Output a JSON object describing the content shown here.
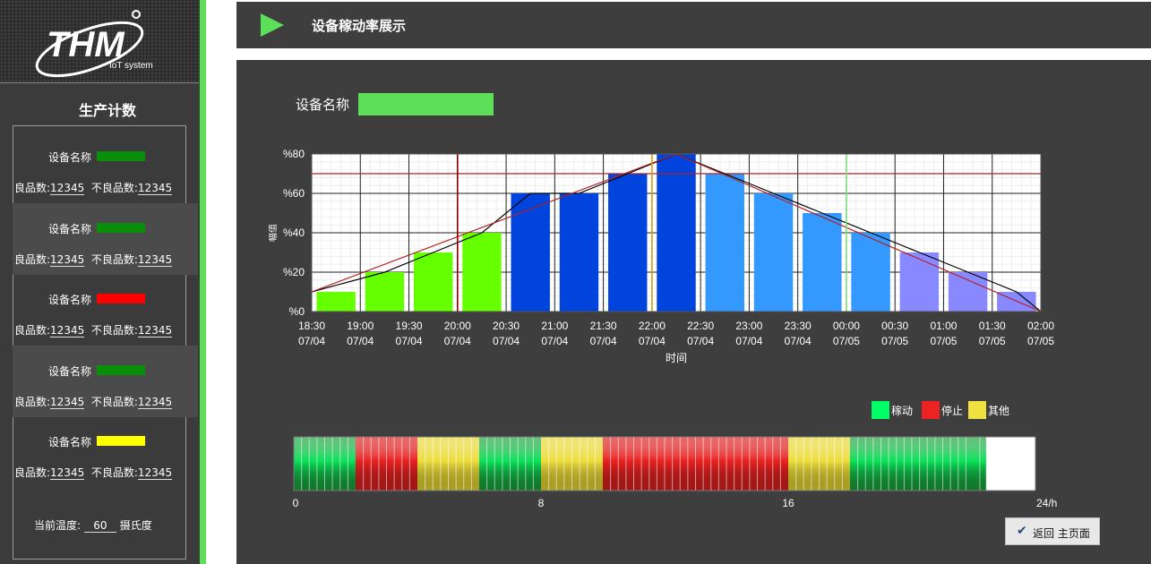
{
  "logo": {
    "brand": "THM",
    "sub": "IoT system"
  },
  "sidebar": {
    "title": "生产计数",
    "cards": [
      {
        "name": "设备名称",
        "status_color": "#0a8f0a",
        "good_label": "良品数:",
        "good_value": "12345",
        "bad_label": "不良品数:",
        "bad_value": "12345"
      },
      {
        "name": "设备名称",
        "status_color": "#0a8f0a",
        "good_label": "良品数:",
        "good_value": "12345",
        "bad_label": "不良品数:",
        "bad_value": "12345"
      },
      {
        "name": "设备名称",
        "status_color": "#ff0000",
        "good_label": "良品数:",
        "good_value": "12345",
        "bad_label": "不良品数:",
        "bad_value": "12345"
      },
      {
        "name": "设备名称",
        "status_color": "#0a8f0a",
        "good_label": "良品数:",
        "good_value": "12345",
        "bad_label": "不良品数:",
        "bad_value": "12345"
      },
      {
        "name": "设备名称",
        "status_color": "#ffff00",
        "good_label": "良品数:",
        "good_value": "12345",
        "bad_label": "不良品数:",
        "bad_value": "12345"
      }
    ],
    "temperature": {
      "label": "当前温度:",
      "value": "60",
      "unit": "摄氏度"
    }
  },
  "header": {
    "title": "设备稼动率展示",
    "icon": "play-icon"
  },
  "device": {
    "label": "设备名称",
    "status_color": "#5ddf5a"
  },
  "chart_data": {
    "type": "bar",
    "xlabel": "时间",
    "ylabel": "幅值",
    "ylim": [
      0,
      80
    ],
    "yticks": [
      "%0",
      "%20",
      "%40",
      "%60",
      "%80"
    ],
    "grid": true,
    "categories": [
      [
        "18:30",
        "07/04"
      ],
      [
        "19:00",
        "07/04"
      ],
      [
        "19:30",
        "07/04"
      ],
      [
        "20:00",
        "07/04"
      ],
      [
        "20:30",
        "07/04"
      ],
      [
        "21:00",
        "07/04"
      ],
      [
        "21:30",
        "07/04"
      ],
      [
        "22:00",
        "07/04"
      ],
      [
        "22:30",
        "07/04"
      ],
      [
        "23:00",
        "07/04"
      ],
      [
        "23:30",
        "07/04"
      ],
      [
        "00:00",
        "07/05"
      ],
      [
        "00:30",
        "07/05"
      ],
      [
        "01:00",
        "07/05"
      ],
      [
        "01:30",
        "07/05"
      ],
      [
        "02:00",
        "07/05"
      ]
    ],
    "values": [
      10,
      20,
      30,
      40,
      60,
      60,
      70,
      80,
      70,
      60,
      50,
      40,
      30,
      20,
      10
    ],
    "bar_colors": [
      "#66ff00",
      "#66ff00",
      "#66ff00",
      "#66ff00",
      "#0044dd",
      "#0044dd",
      "#0044dd",
      "#0044dd",
      "#3399ff",
      "#3399ff",
      "#3399ff",
      "#3399ff",
      "#8888ff",
      "#8888ff",
      "#8888ff"
    ],
    "trend_line": [
      10,
      20,
      30,
      40,
      60,
      60,
      70,
      80,
      70,
      60,
      50,
      40,
      30,
      20,
      10,
      0
    ],
    "reference_line": {
      "value": 70,
      "color": "#b22222"
    },
    "markers": [
      {
        "x": "20:00",
        "color": "#8b0000"
      },
      {
        "x": "22:00",
        "color": "#d4a017"
      },
      {
        "x": "00:00",
        "color": "#7fdd7f"
      }
    ]
  },
  "legend": [
    {
      "label": "稼动",
      "color": "#00ff66"
    },
    {
      "label": "停止",
      "color": "#ee2222"
    },
    {
      "label": "其他",
      "color": "#f0e040"
    }
  ],
  "timeline": {
    "ticks": [
      "0",
      "8",
      "16",
      "24/h"
    ],
    "tick_hours": [
      0,
      8,
      16,
      24
    ],
    "segments": [
      {
        "start": 0,
        "end": 2,
        "state": "稼动"
      },
      {
        "start": 2,
        "end": 4,
        "state": "停止"
      },
      {
        "start": 4,
        "end": 6,
        "state": "其他"
      },
      {
        "start": 6,
        "end": 8,
        "state": "稼动"
      },
      {
        "start": 8,
        "end": 10,
        "state": "其他"
      },
      {
        "start": 10,
        "end": 16,
        "state": "停止"
      },
      {
        "start": 16,
        "end": 18,
        "state": "其他"
      },
      {
        "start": 18,
        "end": 22,
        "state": "稼动"
      },
      {
        "start": 22,
        "end": 22.4,
        "state": "稼动"
      }
    ]
  },
  "return_button": {
    "label": "返回 主页面",
    "icon": "checkmark-icon"
  }
}
